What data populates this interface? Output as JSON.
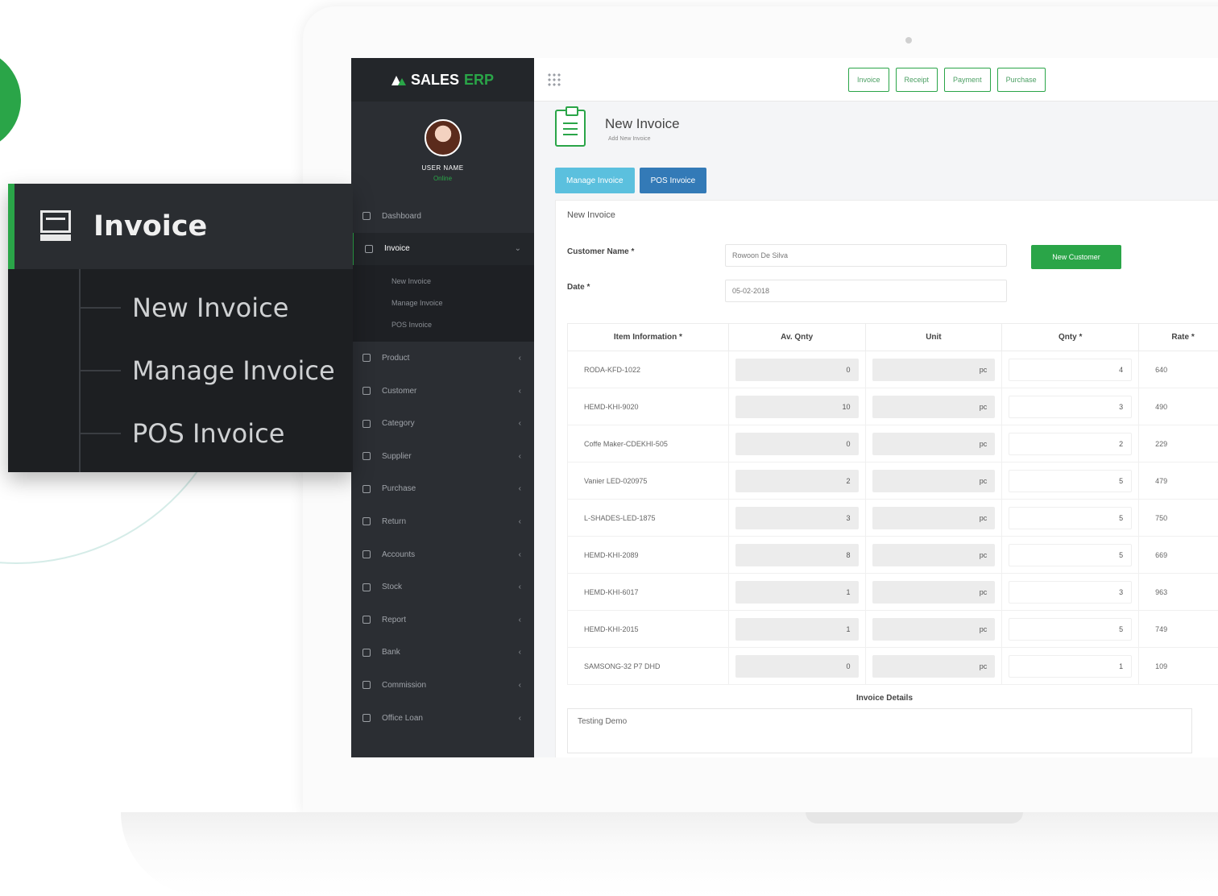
{
  "brand": {
    "name": "SALES",
    "suffix": "ERP"
  },
  "profile": {
    "name": "USER NAME",
    "status": "Online"
  },
  "sidebar": {
    "items": [
      {
        "label": "Dashboard",
        "icon": "dashboard-icon"
      },
      {
        "label": "Invoice",
        "icon": "invoice-icon",
        "active": true
      },
      {
        "label": "Product",
        "icon": "product-icon"
      },
      {
        "label": "Customer",
        "icon": "customer-icon"
      },
      {
        "label": "Category",
        "icon": "category-icon"
      },
      {
        "label": "Supplier",
        "icon": "supplier-icon"
      },
      {
        "label": "Purchase",
        "icon": "purchase-icon"
      },
      {
        "label": "Return",
        "icon": "return-icon"
      },
      {
        "label": "Accounts",
        "icon": "accounts-icon"
      },
      {
        "label": "Stock",
        "icon": "stock-icon"
      },
      {
        "label": "Report",
        "icon": "report-icon"
      },
      {
        "label": "Bank",
        "icon": "bank-icon"
      },
      {
        "label": "Commission",
        "icon": "commission-icon"
      },
      {
        "label": "Office Loan",
        "icon": "loan-icon"
      }
    ],
    "submenu": [
      "New Invoice",
      "Manage Invoice",
      "POS Invoice"
    ]
  },
  "topbar": {
    "buttons": [
      "Invoice",
      "Receipt",
      "Payment",
      "Purchase"
    ]
  },
  "page": {
    "title": "New Invoice",
    "subtitle": "Add New Invoice"
  },
  "tabs": {
    "manage": "Manage Invoice",
    "pos": "POS Invoice"
  },
  "form": {
    "panel_title": "New Invoice",
    "customer_label": "Customer Name *",
    "customer_value": "Rowoon De Silva",
    "new_customer_button": "New Customer",
    "date_label": "Date *",
    "date_value": "05-02-2018"
  },
  "table": {
    "headers": [
      "Item Information *",
      "Av. Qnty",
      "Unit",
      "Qnty *",
      "Rate *"
    ],
    "rows": [
      {
        "item": "RODA-KFD-1022",
        "avqty": "0",
        "unit": "pc",
        "qty": "4",
        "rate": "640"
      },
      {
        "item": "HEMD-KHI-9020",
        "avqty": "10",
        "unit": "pc",
        "qty": "3",
        "rate": "490"
      },
      {
        "item": "Coffe Maker-CDEKHI-505",
        "avqty": "0",
        "unit": "pc",
        "qty": "2",
        "rate": "229"
      },
      {
        "item": "Vanier LED-020975",
        "avqty": "2",
        "unit": "pc",
        "qty": "5",
        "rate": "479"
      },
      {
        "item": "L-SHADES-LED-1875",
        "avqty": "3",
        "unit": "pc",
        "qty": "5",
        "rate": "750"
      },
      {
        "item": "HEMD-KHI-2089",
        "avqty": "8",
        "unit": "pc",
        "qty": "5",
        "rate": "669"
      },
      {
        "item": "HEMD-KHI-6017",
        "avqty": "1",
        "unit": "pc",
        "qty": "3",
        "rate": "963"
      },
      {
        "item": "HEMD-KHI-2015",
        "avqty": "1",
        "unit": "pc",
        "qty": "5",
        "rate": "749"
      },
      {
        "item": "SAMSONG-32 P7 DHD",
        "avqty": "0",
        "unit": "pc",
        "qty": "1",
        "rate": "109"
      }
    ],
    "details_title": "Invoice Details",
    "details_text": "Testing Demo"
  },
  "callout": {
    "title": "Invoice",
    "items": [
      "New Invoice",
      "Manage Invoice",
      "POS Invoice"
    ]
  },
  "colors": {
    "accent": "#2aa548",
    "sidebar": "#2b2e33",
    "callout": "#1d1f22",
    "info": "#5bc0de",
    "primary": "#337ab7"
  }
}
